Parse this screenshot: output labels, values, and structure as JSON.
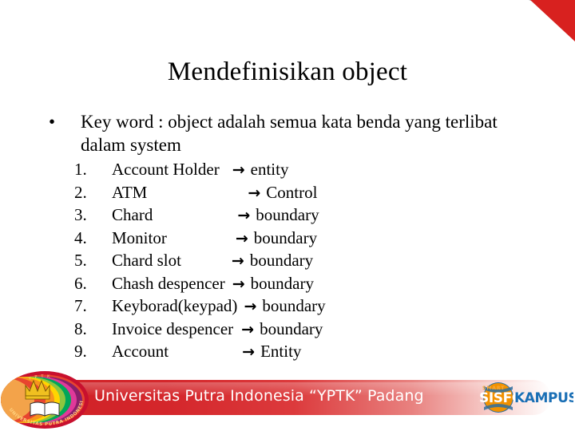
{
  "slide": {
    "title": "Mendefinisikan object",
    "bullet": {
      "marker": "•",
      "text": "Key word : object adalah semua kata benda yang terlibat dalam system"
    },
    "list": [
      {
        "index": "1.",
        "term": "Account Holder",
        "arrow": "→",
        "role": "entity"
      },
      {
        "index": "2.",
        "term": "ATM",
        "arrow": "→",
        "role": "Control"
      },
      {
        "index": "3.",
        "term": "Chard",
        "arrow": "→",
        "role": "boundary"
      },
      {
        "index": "4.",
        "term": "Monitor",
        "arrow": "→",
        "role": "boundary"
      },
      {
        "index": "5.",
        "term": "Chard slot",
        "arrow": "→",
        "role": "boundary"
      },
      {
        "index": "6.",
        "term": "Chash despencer",
        "arrow": "→",
        "role": "boundary"
      },
      {
        "index": "7.",
        "term": "Keyborad(keypad)",
        "arrow": "→",
        "role": "boundary"
      },
      {
        "index": "8.",
        "term": "Invoice despencer",
        "arrow": "→",
        "role": "boundary"
      },
      {
        "index": "9.",
        "term": "Account",
        "arrow": "→",
        "role": "Entity"
      }
    ]
  },
  "footer": {
    "institution": "Universitas Putra Indonesia “YPTK” Padang",
    "university_logo": {
      "ring_text": "UNIVERSITAS PUTRA INDONESIA",
      "top_text": "Y P T K"
    },
    "partner_logo": {
      "small_text": "SMART",
      "part_one": "SISFO",
      "part_two": "KAMPUS"
    }
  },
  "colors": {
    "brand_red": "#cf2026",
    "corner_red": "#d8211f",
    "corner_gray": "#b3b3b3",
    "sisfo_orange": "#f29100",
    "sisfo_blue": "#1a6fb5",
    "text_black": "#000000",
    "footer_text": "#ffffff"
  }
}
